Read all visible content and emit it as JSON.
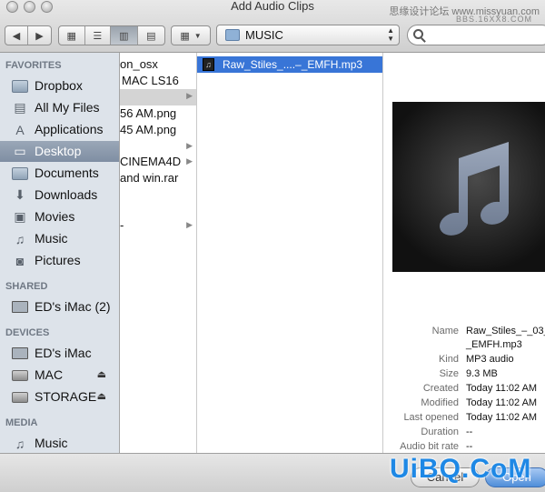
{
  "window": {
    "title": "Add Audio Clips"
  },
  "watermark": {
    "top": "思缘设计论坛 www.missyuan.com",
    "top_small": "BBS.16XX8.COM",
    "logo": "UiBQ.CoM"
  },
  "toolbar": {
    "location": "MUSIC"
  },
  "sidebar": {
    "favorites_header": "FAVORITES",
    "favorites": [
      {
        "label": "Dropbox",
        "icon": "folder-icon"
      },
      {
        "label": "All My Files",
        "icon": "all-files-icon"
      },
      {
        "label": "Applications",
        "icon": "applications-icon"
      },
      {
        "label": "Desktop",
        "icon": "desktop-icon",
        "selected": true
      },
      {
        "label": "Documents",
        "icon": "documents-icon"
      },
      {
        "label": "Downloads",
        "icon": "downloads-icon"
      },
      {
        "label": "Movies",
        "icon": "movies-icon"
      },
      {
        "label": "Music",
        "icon": "music-icon"
      },
      {
        "label": "Pictures",
        "icon": "pictures-icon"
      }
    ],
    "shared_header": "SHARED",
    "shared": [
      {
        "label": "ED's iMac (2)",
        "icon": "imac-icon"
      }
    ],
    "devices_header": "DEVICES",
    "devices": [
      {
        "label": "ED's iMac",
        "icon": "imac-icon"
      },
      {
        "label": "MAC",
        "icon": "drive-icon",
        "eject": true
      },
      {
        "label": "STORAGE",
        "icon": "drive-icon",
        "eject": true
      }
    ],
    "media_header": "MEDIA",
    "media": [
      {
        "label": "Music",
        "icon": "music-icon"
      }
    ]
  },
  "column1": {
    "items": [
      {
        "label": "on_osx"
      },
      {
        "label": "MAC LS16"
      },
      {
        "label": "",
        "folder": true,
        "selected": true
      },
      {
        "label": "56 AM.png"
      },
      {
        "label": "45 AM.png"
      },
      {
        "label": "",
        "folder": true
      },
      {
        "label": "CINEMA4D"
      },
      {
        "label": "and win.rar"
      },
      {
        "label": ""
      },
      {
        "label": "-",
        "folder": true
      }
    ]
  },
  "column2": {
    "selected_file": "Raw_Stiles_....–_EMFH.mp3"
  },
  "preview": {
    "info": [
      {
        "key": "Name",
        "value": "Raw_Stiles_–_03_"
      },
      {
        "key": "",
        "value": "_EMFH.mp3"
      },
      {
        "key": "Kind",
        "value": "MP3 audio"
      },
      {
        "key": "Size",
        "value": "9.3 MB"
      },
      {
        "key": "Created",
        "value": "Today 11:02 AM"
      },
      {
        "key": "Modified",
        "value": "Today 11:02 AM"
      },
      {
        "key": "Last opened",
        "value": "Today 11:02 AM"
      },
      {
        "key": "Duration",
        "value": "--"
      },
      {
        "key": "Audio bit rate",
        "value": "--"
      }
    ]
  },
  "buttons": {
    "cancel": "Cancel",
    "open": "Open"
  }
}
